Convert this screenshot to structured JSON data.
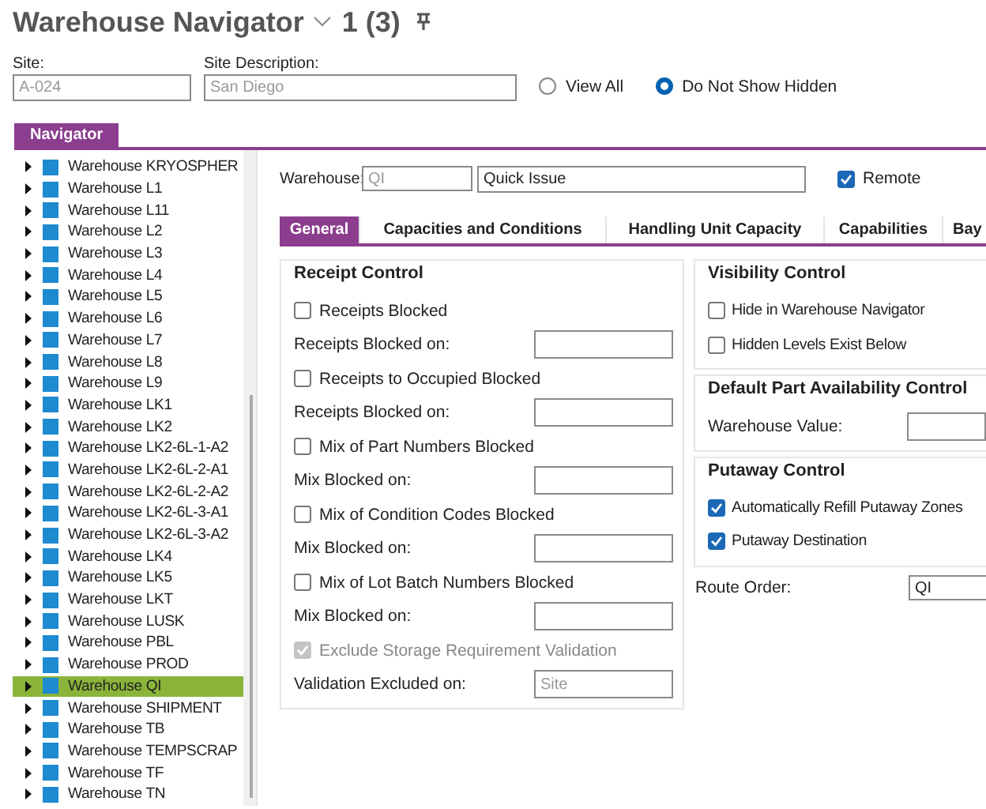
{
  "window": {
    "title": "Warehouse Navigator",
    "count": "1 (3)"
  },
  "header": {
    "fields": [
      {
        "label": "Site:",
        "value": "A-024",
        "disabled": true
      },
      {
        "label": "Site Description:",
        "value": "San Diego",
        "disabled": true
      }
    ],
    "radios": [
      {
        "label": "View All",
        "selected": false
      },
      {
        "label": "Do Not Show Hidden",
        "selected": true
      }
    ]
  },
  "navigator": {
    "tab": "Navigator",
    "items": [
      {
        "label": "Warehouse KRYOSPHER",
        "selected": false
      },
      {
        "label": "Warehouse L1",
        "selected": false
      },
      {
        "label": "Warehouse L11",
        "selected": false
      },
      {
        "label": "Warehouse L2",
        "selected": false
      },
      {
        "label": "Warehouse L3",
        "selected": false
      },
      {
        "label": "Warehouse L4",
        "selected": false
      },
      {
        "label": "Warehouse L5",
        "selected": false
      },
      {
        "label": "Warehouse L6",
        "selected": false
      },
      {
        "label": "Warehouse L7",
        "selected": false
      },
      {
        "label": "Warehouse L8",
        "selected": false
      },
      {
        "label": "Warehouse L9",
        "selected": false
      },
      {
        "label": "Warehouse LK1",
        "selected": false
      },
      {
        "label": "Warehouse LK2",
        "selected": false
      },
      {
        "label": "Warehouse LK2-6L-1-A2",
        "selected": false
      },
      {
        "label": "Warehouse LK2-6L-2-A1",
        "selected": false
      },
      {
        "label": "Warehouse LK2-6L-2-A2",
        "selected": false
      },
      {
        "label": "Warehouse LK2-6L-3-A1",
        "selected": false
      },
      {
        "label": "Warehouse LK2-6L-3-A2",
        "selected": false
      },
      {
        "label": "Warehouse LK4",
        "selected": false
      },
      {
        "label": "Warehouse LK5",
        "selected": false
      },
      {
        "label": "Warehouse LKT",
        "selected": false
      },
      {
        "label": "Warehouse LUSK",
        "selected": false
      },
      {
        "label": "Warehouse PBL",
        "selected": false
      },
      {
        "label": "Warehouse PROD",
        "selected": false
      },
      {
        "label": "Warehouse QI",
        "selected": true
      },
      {
        "label": "Warehouse SHIPMENT",
        "selected": false
      },
      {
        "label": "Warehouse TB",
        "selected": false
      },
      {
        "label": "Warehouse TEMPSCRAP",
        "selected": false
      },
      {
        "label": "Warehouse TF",
        "selected": false
      },
      {
        "label": "Warehouse TN",
        "selected": false
      }
    ]
  },
  "warehouse": {
    "label": "Warehouse:",
    "code": "QI",
    "description": "Quick Issue",
    "remote": {
      "label": "Remote",
      "checked": true
    }
  },
  "tabs": [
    {
      "label": "General",
      "selected": true
    },
    {
      "label": "Capacities and Conditions",
      "selected": false
    },
    {
      "label": "Handling Unit Capacity",
      "selected": false
    },
    {
      "label": "Capabilities",
      "selected": false
    },
    {
      "label": "Bay",
      "selected": false
    }
  ],
  "receipt_control": {
    "title": "Receipt Control",
    "rows": [
      {
        "kind": "checkbox",
        "label": "Receipts Blocked",
        "checked": false
      },
      {
        "kind": "field",
        "label": "Receipts Blocked on:"
      },
      {
        "kind": "checkbox",
        "label": "Receipts to Occupied Blocked",
        "checked": false
      },
      {
        "kind": "field",
        "label": "Receipts Blocked on:"
      },
      {
        "kind": "checkbox",
        "label": "Mix of Part Numbers Blocked",
        "checked": false
      },
      {
        "kind": "field",
        "label": "Mix Blocked on:"
      },
      {
        "kind": "checkbox",
        "label": "Mix of Condition Codes Blocked",
        "checked": false
      },
      {
        "kind": "field",
        "label": "Mix Blocked on:"
      },
      {
        "kind": "checkbox",
        "label": "Mix of Lot Batch Numbers Blocked",
        "checked": false
      },
      {
        "kind": "field",
        "label": "Mix Blocked on:"
      },
      {
        "kind": "checkbox",
        "label": "Exclude Storage Requirement Validation",
        "checked": true,
        "disabled": true
      },
      {
        "kind": "field",
        "label": "Validation Excluded on:",
        "value": "Site",
        "disabled": true
      }
    ]
  },
  "right_groups": [
    {
      "title": "Visibility Control",
      "rows": [
        {
          "kind": "checkbox",
          "label": "Hide in Warehouse Navigator",
          "checked": false
        },
        {
          "kind": "checkbox",
          "label": "Hidden Levels Exist Below",
          "checked": false
        }
      ]
    },
    {
      "title": "Default Part Availability Control",
      "rows": [
        {
          "kind": "field",
          "label": "Warehouse Value:"
        }
      ]
    },
    {
      "title": "Putaway Control",
      "rows": [
        {
          "kind": "checkbox",
          "label": "Automatically Refill Putaway Zones",
          "checked": true
        },
        {
          "kind": "checkbox",
          "label": "Putaway Destination",
          "checked": true
        }
      ]
    }
  ],
  "route_order": {
    "label": "Route Order:",
    "value": "QI"
  }
}
